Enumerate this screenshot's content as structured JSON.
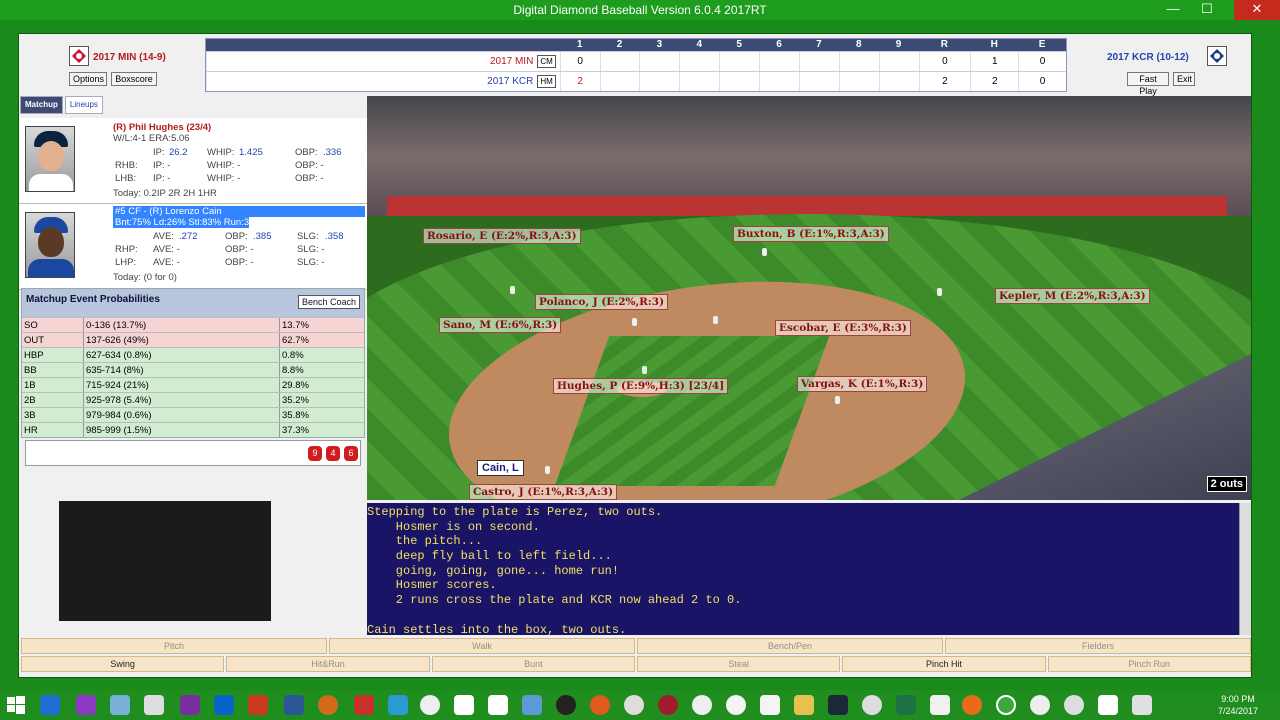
{
  "window": {
    "title": "Digital Diamond Baseball Version 6.0.4 2017RT"
  },
  "away": {
    "name": "2017 MIN (14-9)",
    "btn_options": "Options",
    "btn_boxscore": "Boxscore"
  },
  "home": {
    "name": "2017 KCR (10-12)",
    "btn_fastplay": "Fast Play",
    "btn_exit": "Exit"
  },
  "linescore": {
    "headers": [
      "1",
      "2",
      "3",
      "4",
      "5",
      "6",
      "7",
      "8",
      "9",
      "R",
      "H",
      "E"
    ],
    "rows": [
      {
        "team": "2017 MIN",
        "badge": "CM",
        "innings": [
          "0",
          "",
          "",
          "",
          "",
          "",
          "",
          "",
          ""
        ],
        "R": "0",
        "H": "1",
        "E": "0"
      },
      {
        "team": "2017 KCR",
        "badge": "HM",
        "innings": [
          "2",
          "",
          "",
          "",
          "",
          "",
          "",
          "",
          ""
        ],
        "R": "2",
        "H": "2",
        "E": "0"
      }
    ]
  },
  "tabs": {
    "matchup": "Matchup",
    "lineups": "Lineups"
  },
  "pitcher": {
    "name": "(R) Phil Hughes (23/4)",
    "record": "W/L:4-1 ERA:5.06",
    "ip_l": "IP:",
    "ip": "26.2",
    "whip_l": "WHIP:",
    "whip": "1.425",
    "obp_l": "OBP:",
    "obp": ".336",
    "rhb": "RHB:",
    "rhb_ip": "IP: -",
    "rhb_whip": "WHIP: -",
    "rhb_obp": "OBP: -",
    "lhb": "LHB:",
    "lhb_ip": "IP: -",
    "lhb_whip": "WHIP: -",
    "lhb_obp": "OBP: -",
    "today": "Today: 0.2IP 2R 2H 1HR"
  },
  "batter": {
    "name": "#5 CF - (R) Lorenzo Cain",
    "stats": "Bnt:75% Ld:26% Stl:83% Run:3",
    "ave_l": "AVE:",
    "ave": ".272",
    "obp_l": "OBP:",
    "obp": ".385",
    "slg_l": "SLG:",
    "slg": ".358",
    "rhp": "RHP:",
    "rhp_ave": "AVE: -",
    "rhp_obp": "OBP: -",
    "rhp_slg": "SLG: -",
    "lhp": "LHP:",
    "lhp_ave": "AVE: -",
    "lhp_obp": "OBP: -",
    "lhp_slg": "SLG: -",
    "today": "Today: (0 for 0)"
  },
  "probabilities": {
    "title": "Matchup Event Probabilities",
    "bench_coach": "Bench Coach",
    "rows": [
      {
        "event": "SO",
        "range": "0-136 (13.7%)",
        "cum": "13.7%",
        "kind": "bad"
      },
      {
        "event": "OUT",
        "range": "137-626 (49%)",
        "cum": "62.7%",
        "kind": "bad"
      },
      {
        "event": "HBP",
        "range": "627-634 (0.8%)",
        "cum": "0.8%",
        "kind": "good"
      },
      {
        "event": "BB",
        "range": "635-714 (8%)",
        "cum": "8.8%",
        "kind": "good"
      },
      {
        "event": "1B",
        "range": "715-924 (21%)",
        "cum": "29.8%",
        "kind": "good"
      },
      {
        "event": "2B",
        "range": "925-978 (5.4%)",
        "cum": "35.2%",
        "kind": "good"
      },
      {
        "event": "3B",
        "range": "979-984 (0.6%)",
        "cum": "35.8%",
        "kind": "good"
      },
      {
        "event": "HR",
        "range": "985-999 (1.5%)",
        "cum": "37.3%",
        "kind": "good"
      }
    ],
    "dice": [
      "9",
      "4",
      "6"
    ]
  },
  "fielders": {
    "rosario": "Rosario, E (E:2%,R:3,A:3)",
    "buxton": "Buxton, B (E:1%,R:3,A:3)",
    "kepler": "Kepler, M (E:2%,R:3,A:3)",
    "polanco": "Polanco, J (E:2%,R:3)",
    "sano": "Sano, M (E:6%,R:3)",
    "escobar": "Escobar, E (E:3%,R:3)",
    "hughes": "Hughes, P (E:9%,H:3) [23/4]",
    "vargas": "Vargas, K (E:1%,R:3)",
    "castro": "Castro, J (E:1%,R:3,A:3)"
  },
  "batter_tag": "Cain, L",
  "outs": "2 outs",
  "log": [
    "Stepping to the plate is Perez, two outs.",
    "    Hosmer is on second.",
    "    the pitch...",
    "    deep fly ball to left field...",
    "    going, going, gone... home run!",
    "    Hosmer scores.",
    "    2 runs cross the plate and KCR now ahead 2 to 0.",
    "",
    "Cain settles into the box, two outs."
  ],
  "actions_top": [
    "Pitch",
    "Walk",
    "Bench/Pen",
    "Fielders"
  ],
  "actions_bottom": [
    "Swing",
    "Hit&Run",
    "Bunt",
    "Steal",
    "Pinch Hit",
    "Pinch Run"
  ],
  "clock": {
    "time": "9:00 PM",
    "date": "7/24/2017"
  }
}
